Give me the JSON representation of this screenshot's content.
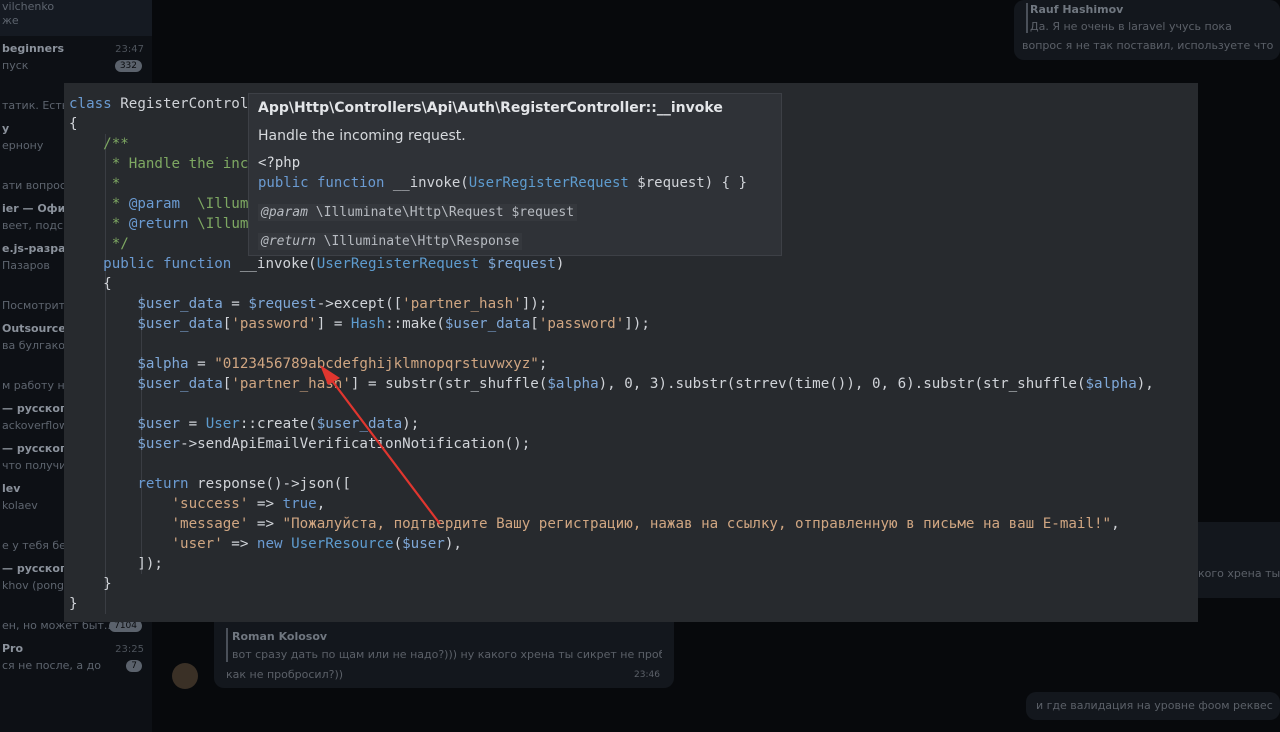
{
  "background": {
    "sidebar": {
      "top_lines": [
        "vilchenko",
        "же"
      ],
      "rows": [
        {
          "title": "beginners",
          "time": "23:47",
          "snippet": "пуск",
          "badge": "332"
        },
        {
          "title": "",
          "time": "",
          "snippet": "татик. Есть л"
        },
        {
          "title": "у",
          "time": "",
          "snippet": "ернону"
        },
        {
          "title": "",
          "time": "",
          "snippet": "ати вопросы"
        },
        {
          "title": "ier — Офиц",
          "time": "",
          "snippet": "веет, подско"
        },
        {
          "title": "e.js-разраб",
          "time": "",
          "snippet": "Пазаров"
        },
        {
          "title": "",
          "time": "",
          "snippet": "Посмотрите н"
        },
        {
          "title": "Outsource",
          "time": "",
          "snippet": "ва булгаков"
        },
        {
          "title": "",
          "time": "",
          "snippet": "м работу не"
        },
        {
          "title": "— русского",
          "time": "",
          "snippet": "ackoverflow"
        },
        {
          "title": "— русского",
          "time": "",
          "snippet": "что получи"
        },
        {
          "title": "lev",
          "time": "",
          "snippet": "kolaev"
        },
        {
          "title": "",
          "time": "",
          "snippet": "е у тебя бе"
        },
        {
          "title": "— русского",
          "time": "",
          "snippet": "khov (pongo)"
        },
        {
          "title": "",
          "time": "",
          "snippet": "ен, но может быт...",
          "badge": "7104"
        },
        {
          "title": "Pro",
          "time": "23:25",
          "snippet": "ся не после, а до",
          "badge": "7"
        }
      ]
    },
    "chat": {
      "top_right": {
        "name": "Rauf Hashimov",
        "quote": "Да. Я не очень в laravel учусь пока",
        "text": "вопрос я не так поставил, используете что"
      },
      "right_mid": "кого хрена ты",
      "bottom_msg": {
        "name": "Roman Kolosov",
        "quote": "вот сразу дать по щам или не надо?))) ну какого хрена ты сикрет не пробр...",
        "text": "как не пробросил?))",
        "time": "23:46"
      },
      "bottom_right": "и где валидация на уровне фоом реквес"
    }
  },
  "editor": {
    "lines": [
      [
        [
          "kw",
          "class "
        ],
        [
          "cls",
          "RegisterController"
        ]
      ],
      [
        [
          "pun",
          "{"
        ]
      ],
      [
        [
          "pun",
          "    "
        ],
        [
          "doc",
          "/**"
        ]
      ],
      [
        [
          "pun",
          "     "
        ],
        [
          "doc",
          "* Handle the incoming request."
        ]
      ],
      [
        [
          "pun",
          "     "
        ],
        [
          "doc",
          "*"
        ]
      ],
      [
        [
          "pun",
          "     "
        ],
        [
          "doc",
          "* "
        ],
        [
          "kw",
          "@param"
        ],
        [
          "doc",
          "  \\Illuminate\\Http\\Request $request"
        ]
      ],
      [
        [
          "pun",
          "     "
        ],
        [
          "doc",
          "* "
        ],
        [
          "kw",
          "@return"
        ],
        [
          "doc",
          " \\Illuminate\\Http\\Response"
        ]
      ],
      [
        [
          "pun",
          "     "
        ],
        [
          "doc",
          "*/"
        ]
      ],
      [
        [
          "pun",
          "    "
        ],
        [
          "kw",
          "public function "
        ],
        [
          "fn",
          "__invoke("
        ],
        [
          "ty",
          "UserRegisterRequest"
        ],
        [
          "pun",
          " "
        ],
        [
          "var",
          "$request"
        ],
        [
          "pun",
          ")"
        ]
      ],
      [
        [
          "pun",
          "    {"
        ]
      ],
      [
        [
          "pun",
          "        "
        ],
        [
          "var",
          "$user_data"
        ],
        [
          "pun",
          " = "
        ],
        [
          "var",
          "$request"
        ],
        [
          "pun",
          "->except(["
        ],
        [
          "str",
          "'partner_hash'"
        ],
        [
          "pun",
          "]);"
        ]
      ],
      [
        [
          "pun",
          "        "
        ],
        [
          "var",
          "$user_data"
        ],
        [
          "pun",
          "["
        ],
        [
          "str",
          "'password'"
        ],
        [
          "pun",
          "] = "
        ],
        [
          "ty",
          "Hash"
        ],
        [
          "pun",
          "::make("
        ],
        [
          "var",
          "$user_data"
        ],
        [
          "pun",
          "["
        ],
        [
          "str",
          "'password'"
        ],
        [
          "pun",
          "]);"
        ]
      ],
      [
        [
          "pun",
          ""
        ]
      ],
      [
        [
          "pun",
          "        "
        ],
        [
          "var",
          "$alpha"
        ],
        [
          "pun",
          " = "
        ],
        [
          "str",
          "\"0123456789abcdefghijklmnopqrstuvwxyz\""
        ],
        [
          "pun",
          ";"
        ]
      ],
      [
        [
          "pun",
          "        "
        ],
        [
          "var",
          "$user_data"
        ],
        [
          "pun",
          "["
        ],
        [
          "str",
          "'partner_hash'"
        ],
        [
          "pun",
          "] = substr(str_shuffle("
        ],
        [
          "var",
          "$alpha"
        ],
        [
          "pun",
          "), 0, 3).substr(strrev(time()), 0, 6).substr(str_shuffle("
        ],
        [
          "var",
          "$alpha"
        ],
        [
          "pun",
          "),"
        ]
      ],
      [
        [
          "pun",
          ""
        ]
      ],
      [
        [
          "pun",
          "        "
        ],
        [
          "var",
          "$user"
        ],
        [
          "pun",
          " = "
        ],
        [
          "ty",
          "User"
        ],
        [
          "pun",
          "::create("
        ],
        [
          "var",
          "$user_data"
        ],
        [
          "pun",
          ");"
        ]
      ],
      [
        [
          "pun",
          "        "
        ],
        [
          "var",
          "$user"
        ],
        [
          "pun",
          "->sendApiEmailVerificationNotification();"
        ]
      ],
      [
        [
          "pun",
          ""
        ]
      ],
      [
        [
          "pun",
          "        "
        ],
        [
          "kw",
          "return"
        ],
        [
          "pun",
          " response()->json(["
        ]
      ],
      [
        [
          "pun",
          "            "
        ],
        [
          "str",
          "'success'"
        ],
        [
          "pun",
          " => "
        ],
        [
          "kw",
          "true"
        ],
        [
          "pun",
          ","
        ]
      ],
      [
        [
          "pun",
          "            "
        ],
        [
          "str",
          "'message'"
        ],
        [
          "pun",
          " => "
        ],
        [
          "str",
          "\"Пожалуйста, подтвердите Вашу регистрацию, нажав на ссылку, отправленную в письме на ваш E-mail!\""
        ],
        [
          "pun",
          ","
        ]
      ],
      [
        [
          "pun",
          "            "
        ],
        [
          "str",
          "'user'"
        ],
        [
          "pun",
          " => "
        ],
        [
          "kw",
          "new "
        ],
        [
          "ty",
          "UserResource"
        ],
        [
          "pun",
          "("
        ],
        [
          "var",
          "$user"
        ],
        [
          "pun",
          "),"
        ]
      ],
      [
        [
          "pun",
          "        ]);"
        ]
      ],
      [
        [
          "pun",
          "    }"
        ]
      ],
      [
        [
          "pun",
          "}"
        ]
      ]
    ]
  },
  "tooltip": {
    "title": "App\\Http\\Controllers\\Api\\Auth\\RegisterController::__invoke",
    "description": "Handle the incoming request.",
    "php_tag": "<?php",
    "signature_parts": [
      [
        "kw",
        "public function "
      ],
      [
        "fn",
        "__invoke("
      ],
      [
        "ty",
        "UserRegisterRequest"
      ],
      [
        "fn",
        " $request) { }"
      ]
    ],
    "param_tag": "@param",
    "param_text": " \\Illuminate\\Http\\Request $request",
    "return_tag": "@return",
    "return_text": " \\Illuminate\\Http\\Response"
  },
  "colors": {
    "editor_bg": "#272a2e",
    "tooltip_bg": "#2f3237",
    "arrow": "#e0362f"
  }
}
